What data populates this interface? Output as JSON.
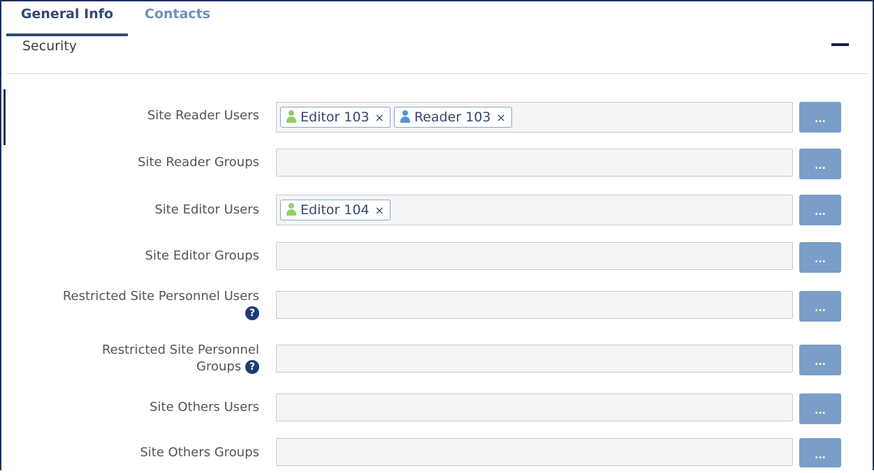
{
  "tabs": [
    {
      "label": "General Info",
      "active": true
    },
    {
      "label": "Contacts",
      "active": false
    }
  ],
  "section": {
    "title": "Security",
    "collapse_icon": "minus-icon"
  },
  "fields": [
    {
      "label": "Site Reader Users",
      "picker_label": "...",
      "chips": [
        {
          "label": "Editor 103",
          "icon": "user-icon",
          "color": "#8fcf6a"
        },
        {
          "label": "Reader 103",
          "icon": "user-icon",
          "color": "#5a92cf"
        }
      ]
    },
    {
      "label": "Site Reader Groups",
      "picker_label": "...",
      "chips": []
    },
    {
      "label": "Site Editor Users",
      "picker_label": "...",
      "chips": [
        {
          "label": "Editor 104",
          "icon": "user-icon",
          "color": "#8fcf6a"
        }
      ]
    },
    {
      "label": "Site Editor Groups",
      "picker_label": "...",
      "chips": []
    },
    {
      "label": "Restricted Site Personnel Users",
      "picker_label": "...",
      "help": true,
      "chips": []
    },
    {
      "label_line1": "Restricted Site Personnel",
      "label_line2": "Groups",
      "picker_label": "...",
      "help": true,
      "chips": []
    },
    {
      "label": "Site Others Users",
      "picker_label": "...",
      "chips": []
    },
    {
      "label": "Site Others Groups",
      "picker_label": "...",
      "chips": []
    }
  ],
  "chip_remove_glyph": "×",
  "help_glyph": "?"
}
